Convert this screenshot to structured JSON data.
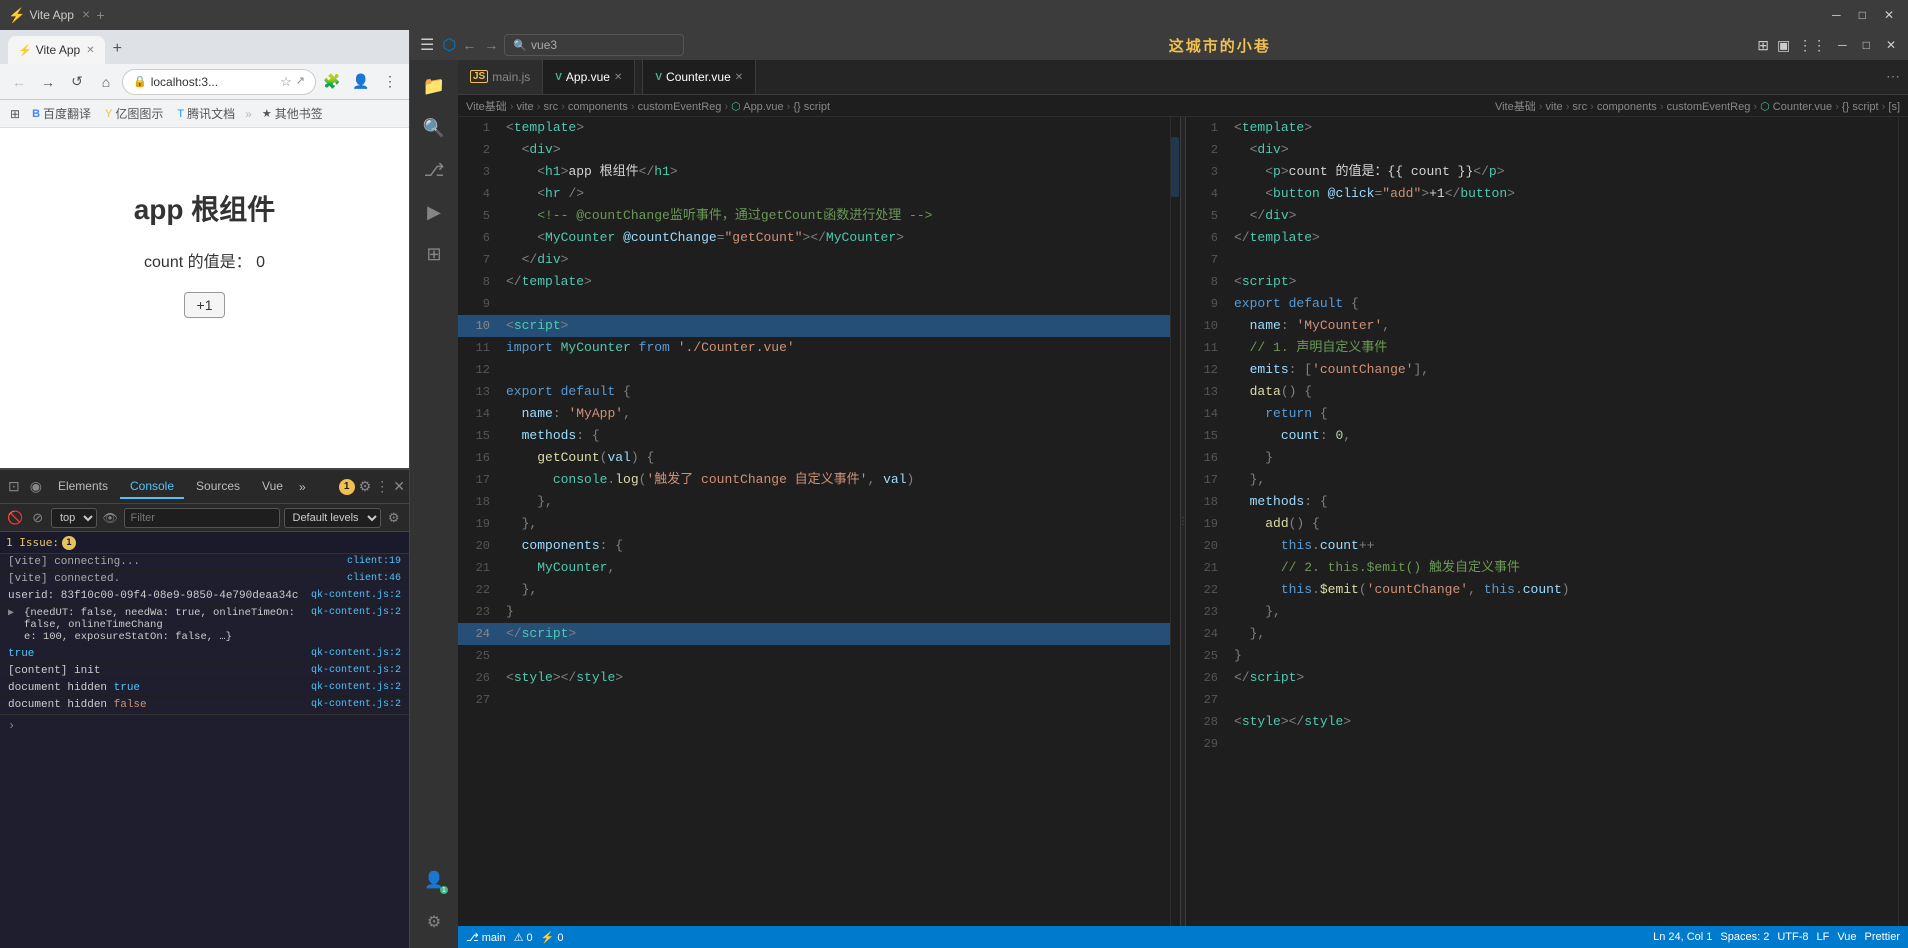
{
  "browser": {
    "tab_title": "Vite App",
    "url": "localhost:3...",
    "bookmarks": [
      "百度翻译",
      "亿图图示",
      "腾讯文档",
      "其他书签"
    ],
    "bookmark_icons": [
      "B",
      "Y",
      "T",
      "★"
    ],
    "app_title": "app 根组件",
    "count_label": "count 的值是：",
    "count_value": "0",
    "add_button": "+1"
  },
  "devtools": {
    "tabs": [
      "Elements",
      "Console",
      "Sources",
      "Vue"
    ],
    "active_tab": "Console",
    "more_label": "»",
    "toolbar": {
      "context": "top",
      "filter_placeholder": "Filter",
      "levels": "Default levels"
    },
    "issues_label": "1 Issue:",
    "issues_count": "1",
    "console_lines": [
      {
        "text": "[vite] connecting...",
        "source": "client:19",
        "type": "info"
      },
      {
        "text": "[vite] connected.",
        "source": "client:46",
        "type": "info"
      },
      {
        "text": "userid: 83f10c00-09f4-08e9-9850-4e790deaa34c",
        "source": "qk-content.js:2",
        "type": "normal"
      },
      {
        "text": "{needUT: false, needWa: true, onlineTimeOn: false, onlineTimeChange: 100, exposureStatOn: false, …}",
        "source": "qk-content.js:2",
        "type": "normal"
      },
      {
        "text": "true",
        "source": "qk-content.js:2",
        "type": "normal"
      },
      {
        "text": "[content] init",
        "source": "qk-content.js:2",
        "type": "normal"
      },
      {
        "text": "document hidden true",
        "source": "qk-content.js:2",
        "type": "normal"
      },
      {
        "text": "document hidden false",
        "source": "qk-content.js:2",
        "type": "normal"
      }
    ]
  },
  "editor": {
    "banner": "这城市的小巷",
    "left_tab": {
      "lang_icon": "JS",
      "filename": "main.js",
      "color": "#f0c050"
    },
    "right_tab": {
      "lang_icon": "V",
      "filename": "App.vue",
      "color": "#42b883",
      "active": true
    },
    "right_tab2": {
      "lang_icon": "V",
      "filename": "Counter.vue",
      "color": "#42b883",
      "active": true
    },
    "breadcrumb_left": "Vite基础 > vite > src > components > customEventReg > App.vue > {} script",
    "breadcrumb_right": "Vite基础 > vite > src > components > customEventReg > Counter.vue > {} script > [s]",
    "app_vue_lines": [
      {
        "n": 1,
        "code": "<span class='punct'>&lt;</span><span class='html-tag'>template</span><span class='punct'>&gt;</span>"
      },
      {
        "n": 2,
        "code": "  <span class='punct'>&lt;</span><span class='html-tag'>div</span><span class='punct'>&gt;</span>"
      },
      {
        "n": 3,
        "code": "    <span class='punct'>&lt;</span><span class='html-tag'>h1</span><span class='punct'>&gt;</span><span class='light'>app 根组件</span><span class='punct'>&lt;/</span><span class='html-tag'>h1</span><span class='punct'>&gt;</span>"
      },
      {
        "n": 4,
        "code": "    <span class='punct'>&lt;</span><span class='html-tag'>hr</span> <span class='punct'>/&gt;</span>"
      },
      {
        "n": 5,
        "code": "    <span class='cmt'>&lt;!-- @countChange监听事件，通过getCount函数进行处理 --&gt;</span>"
      },
      {
        "n": 6,
        "code": "    <span class='punct'>&lt;</span><span class='vue-tag'>MyCounter</span> <span class='attr'>@countChange</span><span class='punct'>=</span><span class='str'>\"getCount\"</span><span class='punct'>&gt;&lt;/</span><span class='vue-tag'>MyCounter</span><span class='punct'>&gt;</span>"
      },
      {
        "n": 7,
        "code": "  <span class='punct'>&lt;/</span><span class='html-tag'>div</span><span class='punct'>&gt;</span>"
      },
      {
        "n": 8,
        "code": "<span class='punct'>&lt;/</span><span class='html-tag'>template</span><span class='punct'>&gt;</span>"
      },
      {
        "n": 9,
        "code": ""
      },
      {
        "n": 10,
        "code": "<span class='tag-highlight'><span class='punct'>&lt;</span><span class='html-tag'>script</span><span class='punct'>&gt;</span></span>"
      },
      {
        "n": 11,
        "code": "<span class='kw'>import</span> <span class='teal'>MyCounter</span> <span class='kw'>from</span> <span class='str'>'./Counter.vue'</span>"
      },
      {
        "n": 12,
        "code": ""
      },
      {
        "n": 13,
        "code": "<span class='kw'>export default</span> <span class='punct'>{</span>"
      },
      {
        "n": 14,
        "code": "  <span class='prop'>name</span><span class='punct'>:</span> <span class='str'>'MyApp'</span><span class='punct'>,</span>"
      },
      {
        "n": 15,
        "code": "  <span class='prop'>methods</span><span class='punct'>: {</span>"
      },
      {
        "n": 16,
        "code": "    <span class='fn'>getCount</span><span class='punct'>(</span><span class='var'>val</span><span class='punct'>) {</span>"
      },
      {
        "n": 17,
        "code": "      <span class='teal'>console</span><span class='punct'>.</span><span class='fn'>log</span><span class='punct'>(</span><span class='str'>'触发了 countChange 自定义事件'</span><span class='punct'>,</span> <span class='var'>val</span><span class='punct'>)</span>"
      },
      {
        "n": 18,
        "code": "    <span class='punct'>},</span>"
      },
      {
        "n": 19,
        "code": "  <span class='punct'>},</span>"
      },
      {
        "n": 20,
        "code": "  <span class='prop'>components</span><span class='punct'>: {</span>"
      },
      {
        "n": 21,
        "code": "    <span class='teal'>MyCounter</span><span class='punct'>,</span>"
      },
      {
        "n": 22,
        "code": "  <span class='punct'>},</span>"
      },
      {
        "n": 23,
        "code": "<span class='punct'>}</span>"
      },
      {
        "n": 24,
        "code": "<span class='tag-highlight'><span class='punct'>&lt;/</span><span class='html-tag'>script</span><span class='punct'>&gt;</span></span>"
      },
      {
        "n": 25,
        "code": ""
      },
      {
        "n": 26,
        "code": "<span class='punct'>&lt;</span><span class='html-tag'>style</span><span class='punct'>&gt;&lt;/</span><span class='html-tag'>style</span><span class='punct'>&gt;</span>"
      },
      {
        "n": 27,
        "code": ""
      }
    ],
    "counter_vue_lines": [
      {
        "n": 1,
        "code": "<span class='punct'>&lt;</span><span class='html-tag'>template</span><span class='punct'>&gt;</span>"
      },
      {
        "n": 2,
        "code": "  <span class='punct'>&lt;</span><span class='html-tag'>div</span><span class='punct'>&gt;</span>"
      },
      {
        "n": 3,
        "code": "    <span class='punct'>&lt;</span><span class='html-tag'>p</span><span class='punct'>&gt;</span><span class='light'>count 的值是：{{ count }}</span><span class='punct'>&lt;/</span><span class='html-tag'>p</span><span class='punct'>&gt;</span>"
      },
      {
        "n": 4,
        "code": "    <span class='punct'>&lt;</span><span class='html-tag'>button</span> <span class='attr'>@click</span><span class='punct'>=</span><span class='str'>\"add\"</span><span class='punct'>&gt;</span><span class='light'>+1</span><span class='punct'>&lt;/</span><span class='html-tag'>button</span><span class='punct'>&gt;</span>"
      },
      {
        "n": 5,
        "code": "  <span class='punct'>&lt;/</span><span class='html-tag'>div</span><span class='punct'>&gt;</span>"
      },
      {
        "n": 6,
        "code": "<span class='punct'>&lt;/</span><span class='html-tag'>template</span><span class='punct'>&gt;</span>"
      },
      {
        "n": 7,
        "code": ""
      },
      {
        "n": 8,
        "code": "<span class='punct'>&lt;</span><span class='html-tag'>script</span><span class='punct'>&gt;</span>"
      },
      {
        "n": 9,
        "code": "<span class='kw'>export default</span> <span class='punct'>{</span>"
      },
      {
        "n": 10,
        "code": "  <span class='prop'>name</span><span class='punct'>:</span> <span class='str'>'MyCounter'</span><span class='punct'>,</span>"
      },
      {
        "n": 11,
        "code": "  <span class='cmt'>// 1. 声明自定义事件</span>"
      },
      {
        "n": 12,
        "code": "  <span class='prop'>emits</span><span class='punct'>:</span> <span class='punct'>[</span><span class='str'>'countChange'</span><span class='punct'>],</span>"
      },
      {
        "n": 13,
        "code": "  <span class='fn'>data</span><span class='punct'>() {</span>"
      },
      {
        "n": 14,
        "code": "    <span class='kw'>return</span> <span class='punct'>{</span>"
      },
      {
        "n": 15,
        "code": "      <span class='prop'>count</span><span class='punct'>:</span> <span class='num'>0</span><span class='punct'>,</span>"
      },
      {
        "n": 16,
        "code": "    <span class='punct'>}</span>"
      },
      {
        "n": 17,
        "code": "  <span class='punct'>},</span>"
      },
      {
        "n": 18,
        "code": "  <span class='prop'>methods</span><span class='punct'>: {</span>"
      },
      {
        "n": 19,
        "code": "    <span class='fn'>add</span><span class='punct'>() {</span>"
      },
      {
        "n": 20,
        "code": "      <span class='kw'>this</span><span class='punct'>.</span><span class='var'>count</span><span class='punct'>++</span>"
      },
      {
        "n": 21,
        "code": "      <span class='cmt'>// 2. this.$emit() 触发自定义事件</span>"
      },
      {
        "n": 22,
        "code": "      <span class='kw'>this</span><span class='punct'>.</span><span class='fn'>$emit</span><span class='punct'>(</span><span class='str'>'countChange'</span><span class='punct'>,</span> <span class='kw'>this</span><span class='punct'>.</span><span class='var'>count</span><span class='punct'>)</span>"
      },
      {
        "n": 23,
        "code": "    <span class='punct'>},</span>"
      },
      {
        "n": 24,
        "code": "  <span class='punct'>},</span>"
      },
      {
        "n": 25,
        "code": "<span class='punct'>}</span>"
      },
      {
        "n": 26,
        "code": "<span class='punct'>&lt;/</span><span class='html-tag'>script</span><span class='punct'>&gt;</span>"
      },
      {
        "n": 27,
        "code": ""
      },
      {
        "n": 28,
        "code": "<span class='punct'>&lt;</span><span class='html-tag'>style</span><span class='punct'>&gt;&lt;/</span><span class='html-tag'>style</span><span class='punct'>&gt;</span>"
      },
      {
        "n": 29,
        "code": ""
      }
    ]
  },
  "statusbar": {
    "left_items": [
      "⎇ main",
      "⚠ 0",
      "⚡ 0"
    ],
    "right_items": [
      "Ln 24, Col 1",
      "Spaces: 2",
      "UTF-8",
      "LF",
      "Vue",
      "Prettier"
    ]
  }
}
